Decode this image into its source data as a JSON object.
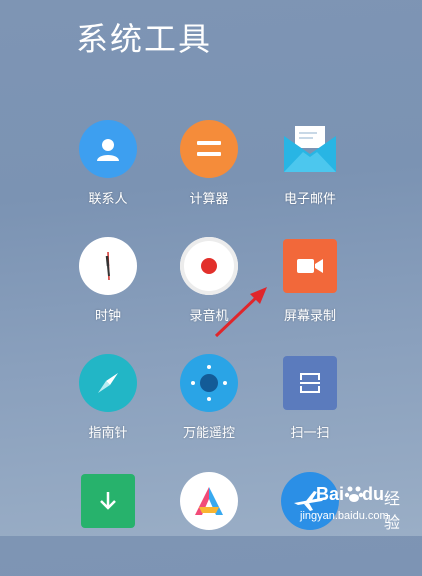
{
  "folder": {
    "title": "系统工具"
  },
  "apps": [
    {
      "label": "联系人",
      "icon": "contacts-icon",
      "color": "#3d9ff0"
    },
    {
      "label": "计算器",
      "icon": "calculator-icon",
      "color": "#f58c3a"
    },
    {
      "label": "电子邮件",
      "icon": "email-icon",
      "color": "#28b5e4"
    },
    {
      "label": "时钟",
      "icon": "clock-icon",
      "color": "#ffffff"
    },
    {
      "label": "录音机",
      "icon": "recorder-icon",
      "color": "#e2302b"
    },
    {
      "label": "屏幕录制",
      "icon": "screen-recorder-icon",
      "color": "#f2683a"
    },
    {
      "label": "指南针",
      "icon": "compass-icon",
      "color": "#22b6c6"
    },
    {
      "label": "万能遥控",
      "icon": "remote-control-icon",
      "color": "#2aa4e6"
    },
    {
      "label": "扫一扫",
      "icon": "scanner-icon",
      "color": "#5b7bbd"
    },
    {
      "label": "",
      "icon": "download-icon",
      "color": "#27b26c"
    },
    {
      "label": "",
      "icon": "app-store-icon",
      "color": "#ffffff"
    },
    {
      "label": "",
      "icon": "plane-icon",
      "color": "#2b8fe6"
    }
  ],
  "watermark": {
    "brand": "Bai",
    "brand2": "du",
    "suffix": "经验",
    "url": "jingyan.baidu.com"
  },
  "annotation": {
    "color": "#e0262b"
  }
}
